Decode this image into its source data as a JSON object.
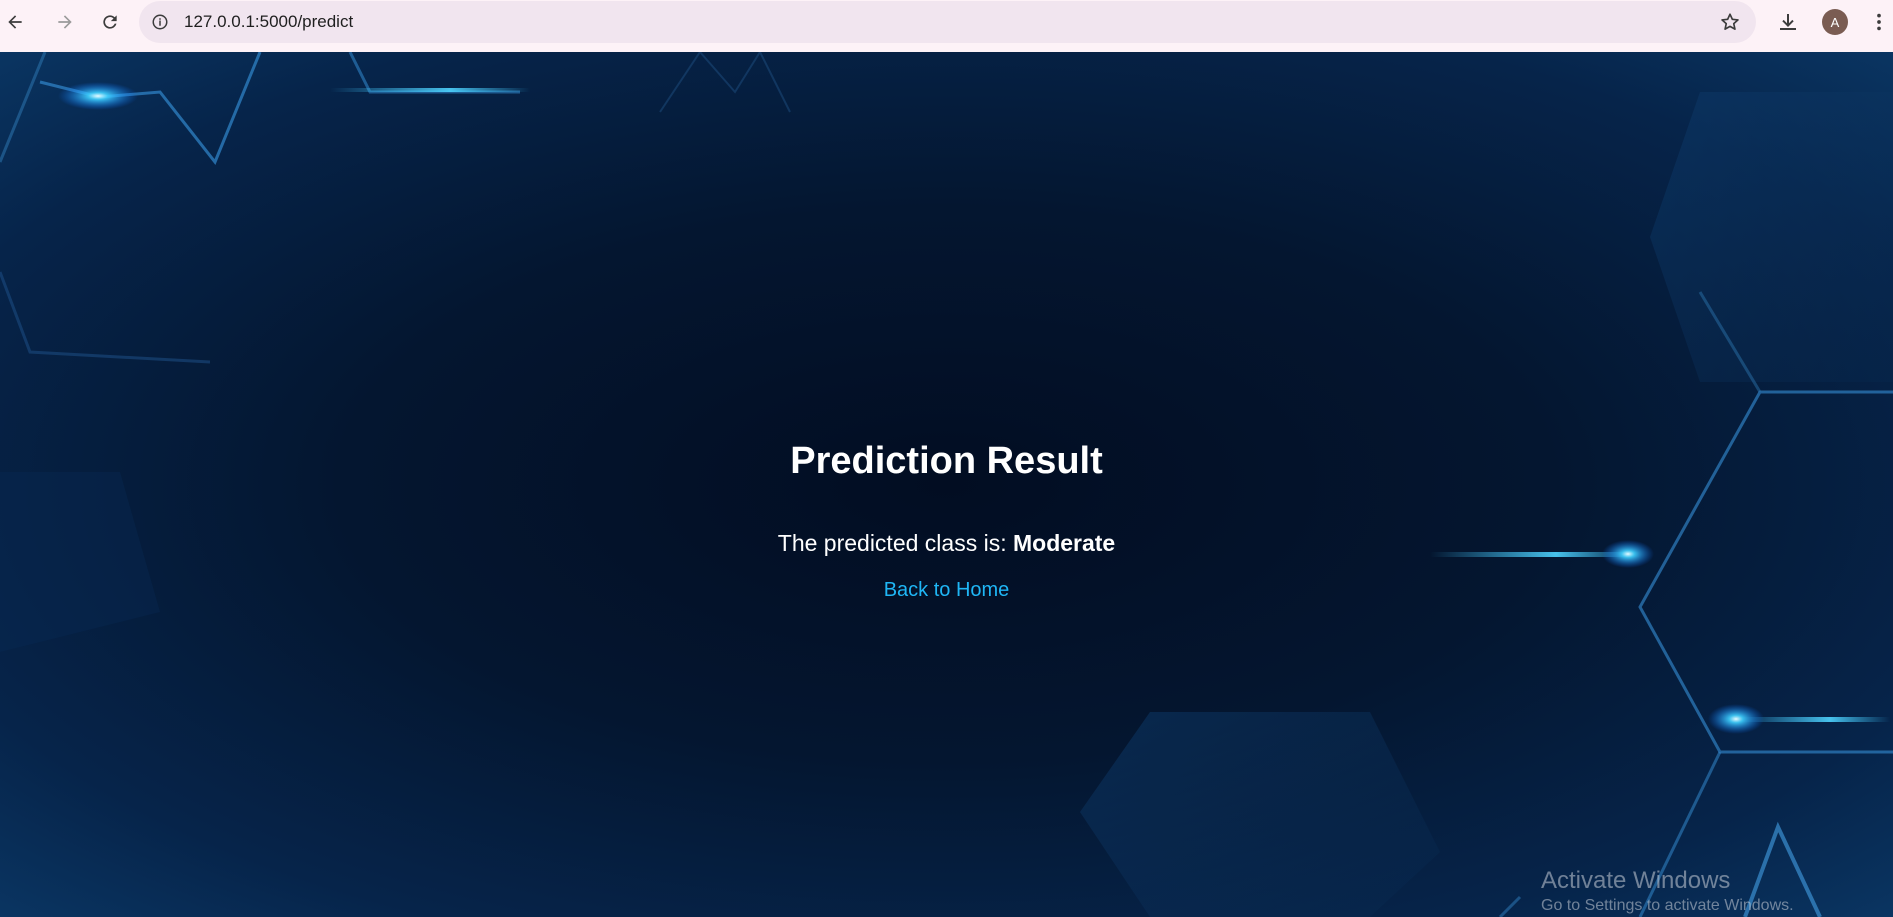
{
  "browser": {
    "url": "127.0.0.1:5000/predict",
    "profile_initial": "A",
    "icons": {
      "back": "arrow-left-icon",
      "forward": "arrow-right-icon",
      "reload": "reload-icon",
      "site_info": "info-icon",
      "bookmark": "star-icon",
      "download": "download-icon",
      "menu": "kebab-menu-icon"
    }
  },
  "page": {
    "title": "Prediction Result",
    "result_prefix": "The predicted class is: ",
    "result_value": "Moderate",
    "back_link": "Back to Home",
    "link_color": "#1fb6f5"
  },
  "os_watermark": {
    "title": "Activate Windows",
    "subtitle": "Go to Settings to activate Windows."
  }
}
